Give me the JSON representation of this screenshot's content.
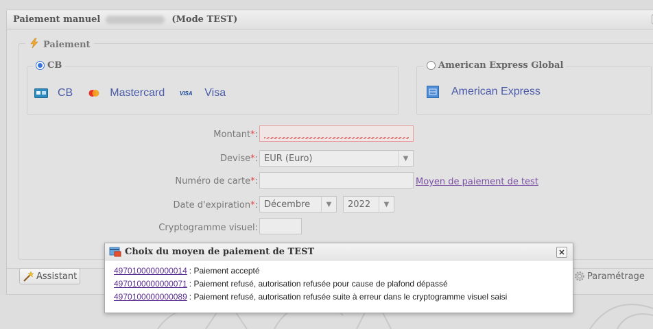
{
  "window": {
    "title": "Paiement manuel",
    "mode": "(Mode TEST)"
  },
  "payment_section": {
    "legend": "Paiement",
    "cb_group": {
      "label": "CB",
      "selected": true,
      "brands": [
        "CB",
        "Mastercard",
        "Visa"
      ]
    },
    "amex_group": {
      "label": "American Express Global",
      "selected": false,
      "brand": "American Express"
    }
  },
  "form": {
    "amount": {
      "label": "Montant",
      "required_mark": "*",
      "suffix": ":",
      "value": ""
    },
    "currency": {
      "label": "Devise",
      "required_mark": "*",
      "suffix": ":",
      "value": "EUR (Euro)"
    },
    "card_number": {
      "label": "Numéro de carte",
      "required_mark": "*",
      "suffix": ":",
      "value": ""
    },
    "expiry": {
      "label": "Date d'expiration",
      "required_mark": "*",
      "suffix": ":",
      "month": "Décembre",
      "year": "2022"
    },
    "cvv": {
      "label": "Cryptogramme visuel:",
      "value": ""
    },
    "test_link": "Moyen de paiement de test"
  },
  "buttons": {
    "assistant": "Assistant",
    "settings": "Paramétrage"
  },
  "popup": {
    "title": "Choix du moyen de paiement de TEST",
    "close": "✕",
    "options": [
      {
        "card": "4970100000000014",
        "text": ": Paiement accepté"
      },
      {
        "card": "4970100000000071",
        "text": ": Paiement refusé, autorisation refusée pour cause de plafond dépassé"
      },
      {
        "card": "4970100000000089",
        "text": ": Paiement refusé, autorisation refusée suite à erreur dans le cryptogramme visuel saisi"
      }
    ]
  },
  "colors": {
    "link": "#5b2d91",
    "required": "#e24545",
    "brand_text": "#4a5ba8",
    "radio_selected": "#3a76d8"
  }
}
